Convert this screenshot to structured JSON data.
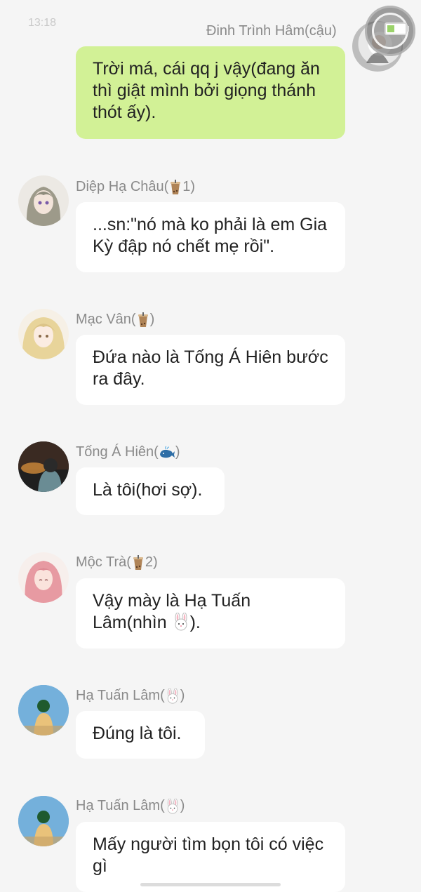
{
  "status_bar": {
    "time": "13:18"
  },
  "messages": [
    {
      "id": "msg-1",
      "sender": "Đinh Trình Hâm(cậu)",
      "text": "Trời má, cái qq j vậy(đang ăn thì giật mình bởi giọng thánh thót ấy).",
      "self": true
    },
    {
      "id": "msg-2",
      "sender": "Diệp Hạ Châu(",
      "badge": "1",
      "sender_suffix": ")",
      "text": "...sn:\"nó mà ko phải là em Gia Kỳ đập nó chết mẹ rồi\".",
      "self": false
    },
    {
      "id": "msg-3",
      "sender": "Mạc Vân(",
      "sender_suffix": ")",
      "text": "Đứa nào là Tống Á Hiên bước ra đây.",
      "self": false
    },
    {
      "id": "msg-4",
      "sender": "Tống Á Hiên(",
      "sender_suffix": ")",
      "text": "Là tôi(hơi sợ).",
      "self": false
    },
    {
      "id": "msg-5",
      "sender": "Mộc Trà(",
      "badge": "2",
      "sender_suffix": ")",
      "text_before": "Vậy mày là Hạ Tuấn Lâm(nhìn ",
      "text_after": ").",
      "self": false
    },
    {
      "id": "msg-6",
      "sender": "Hạ Tuấn Lâm(",
      "sender_suffix": ")",
      "text": "Đúng là tôi.",
      "self": false
    },
    {
      "id": "msg-7",
      "sender": "Hạ Tuấn Lâm(",
      "sender_suffix": ")",
      "text": "Mấy người tìm bọn tôi có việc gì",
      "self": false
    }
  ],
  "colors": {
    "self_bubble": "#d2f196",
    "other_bubble": "#ffffff",
    "background": "#f5f5f5",
    "name": "#8a8a8a"
  },
  "icons": {
    "drink": "bubble-tea-icon",
    "whale": "whale-icon",
    "rabbit": "rabbit-face-icon"
  }
}
